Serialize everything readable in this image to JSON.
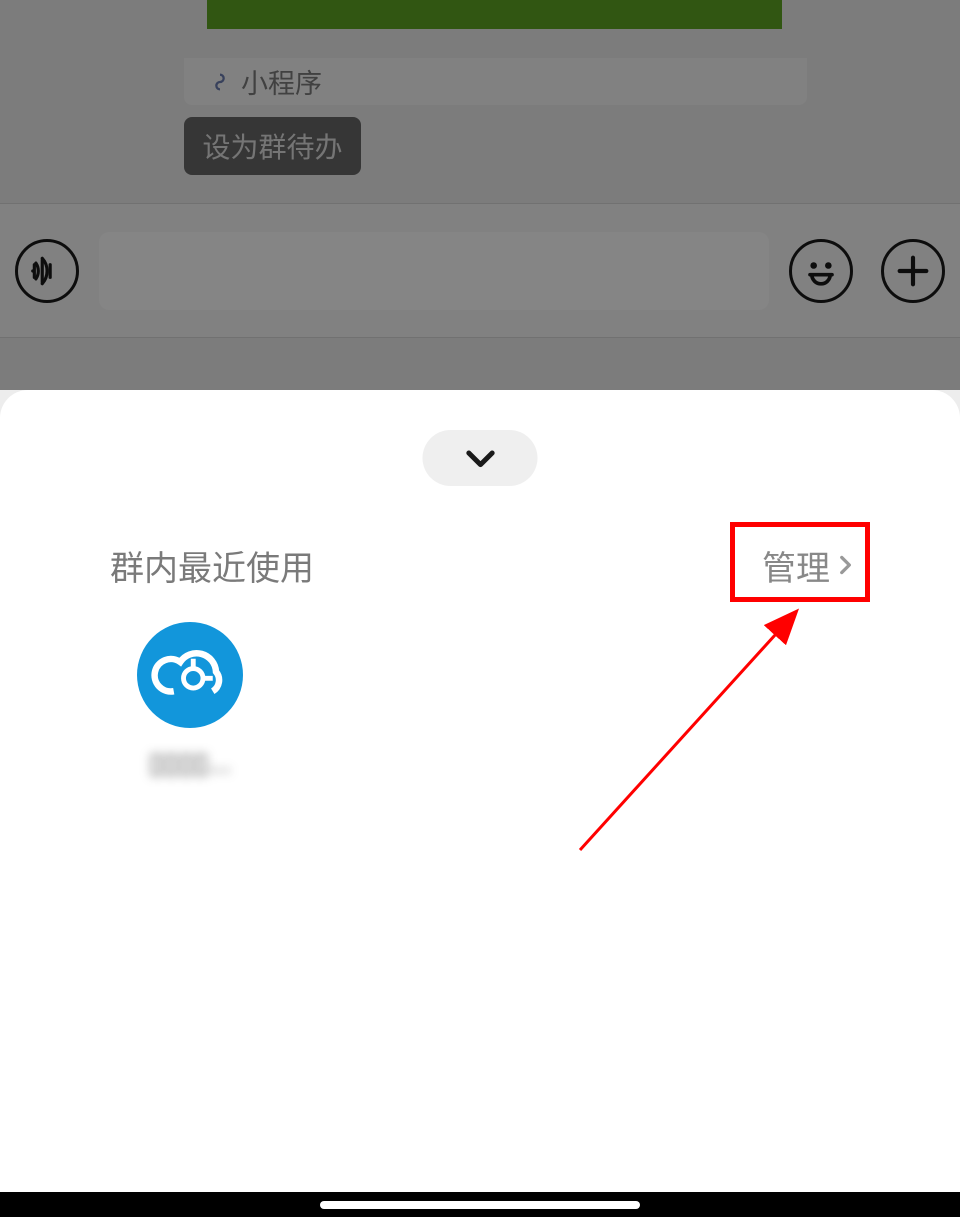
{
  "chat": {
    "miniprogram_label": "小程序",
    "todo_button_label": "设为群待办"
  },
  "panel": {
    "section_title": "群内最近使用",
    "manage_label": "管理",
    "app_name": "▯▯▯▯..."
  },
  "icons": {
    "voice": "voice-icon",
    "emoji": "emoji-icon",
    "plus": "plus-icon",
    "chevron_down": "chevron-down-icon",
    "chevron_right": "chevron-right-icon",
    "miniprogram": "miniprogram-icon",
    "cloud": "cloud-icon"
  }
}
